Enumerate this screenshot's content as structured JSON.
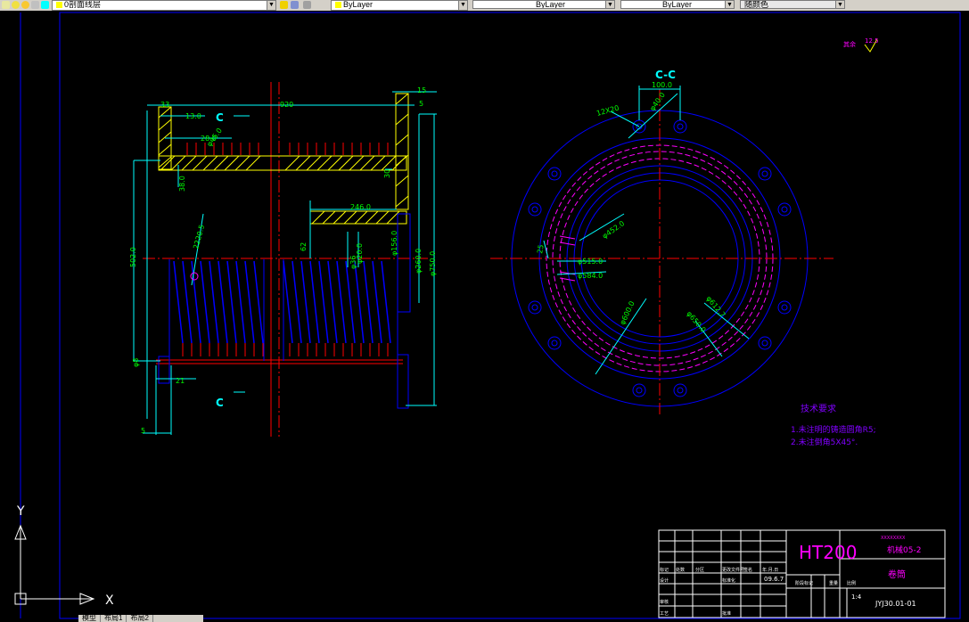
{
  "toolbar": {
    "layer_value": "0剖面线层",
    "color_value": "ByLayer",
    "linetype_value": "ByLayer",
    "lineweight_value": "ByLayer",
    "plotstyle_value": "随颜色"
  },
  "drawing": {
    "section_view_label_top": "C",
    "section_view_label_bottom": "C",
    "section_title": "C-C",
    "dims_left": {
      "overall_length": "920",
      "d15": "15",
      "d5_top": "5",
      "d33": "33",
      "d13": "13.0",
      "d28": "28.0",
      "d45": "φ45.0",
      "d38": "38.0",
      "d246": "246.0",
      "d22025": "2220.5",
      "d502": "502.0",
      "d30": "30",
      "d62": "62",
      "d156": "φ156.0",
      "d260": "φ260.0",
      "d750": "φ750.0",
      "d21": "21",
      "d5_bottom": "5",
      "d8": "φ8",
      "dim_a": "φ36",
      "dim_b": "φ20.0"
    },
    "dims_right": {
      "d100": "100.0",
      "d12": "12X20",
      "d40": "φ40.0",
      "d452": "φ452.0",
      "d515": "φ515.0",
      "d584": "φ584.0",
      "d600": "φ600.0",
      "d612": "φ612.7",
      "d650": "φ650.0",
      "d25": "25"
    },
    "roughness": {
      "label": "其余",
      "value": "12.5"
    },
    "notes": {
      "title": "技术要求",
      "line1": "1.未注明的铸造圆角R5;",
      "line2": "2.未注倒角5X45°."
    },
    "ucs": {
      "x_label": "X",
      "y_label": "Y"
    }
  },
  "title_block": {
    "material": "HT200",
    "school": "XXXXXXXX",
    "class_no": "机械05-2",
    "part_name": "卷筒",
    "drawing_no": "JYJ30.01-01",
    "scale": "1:4",
    "date": "09.6.7",
    "h_mark": "标记",
    "h_count": "处数",
    "h_zone": "分区",
    "h_file": "更改文件号",
    "h_sign": "签名",
    "h_date": "年.月.日",
    "r_design": "设计",
    "r_std": "标准化",
    "r_stage": "阶段标记",
    "r_weight": "重量",
    "r_scale": "比例",
    "r_review": "审核",
    "r_craft": "工艺",
    "r_approve": "批准"
  },
  "bottom_tabs": [
    "模型",
    "布局1",
    "布局2"
  ],
  "colors": {
    "border": "#0000ff",
    "dimension": "#00ffff",
    "centerline": "#ff0000",
    "hatch": "#ffff00",
    "text_green": "#00ff00",
    "text_magenta": "#ff00ff",
    "white": "#ffffff"
  }
}
